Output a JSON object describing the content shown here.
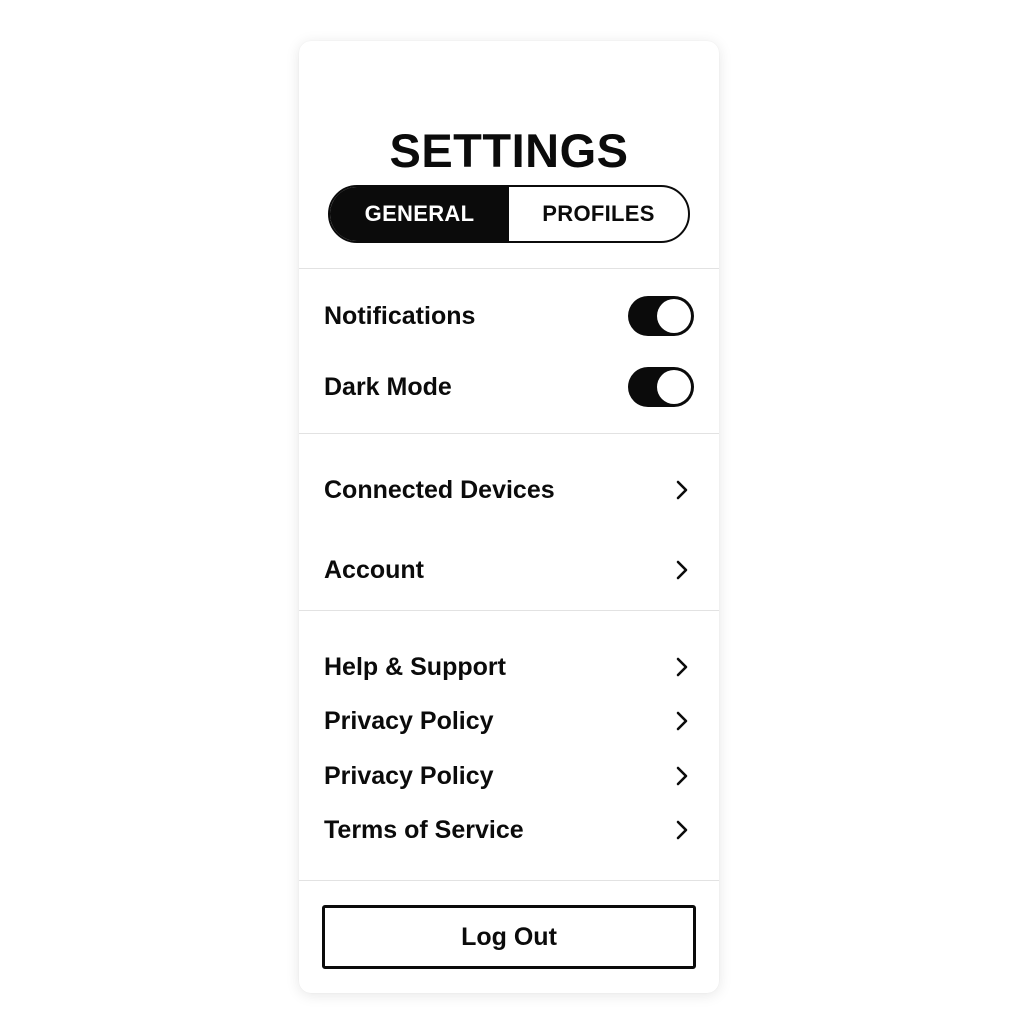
{
  "header": {
    "title": "SETTINGS"
  },
  "tabs": [
    {
      "label": "GENERAL",
      "active": true
    },
    {
      "label": "PROFILES",
      "active": false
    }
  ],
  "toggles": [
    {
      "label": "Notifications",
      "on": true,
      "icon": "toggle-switch"
    },
    {
      "label": "Dark Mode",
      "on": true,
      "icon": "toggle-switch"
    }
  ],
  "links_group_1": [
    {
      "label": "Connected Devices",
      "icon": "chevron-right-icon"
    },
    {
      "label": "Account",
      "icon": "chevron-right-icon"
    }
  ],
  "links_group_2": [
    {
      "label": "Help & Support",
      "icon": "chevron-right-icon"
    },
    {
      "label": "Privacy Policy",
      "icon": "chevron-right-icon"
    },
    {
      "label": "Privacy Policy",
      "icon": "chevron-right-icon"
    },
    {
      "label": "Terms of Service",
      "icon": "chevron-right-icon"
    }
  ],
  "footer": {
    "logout_label": "Log Out"
  },
  "colors": {
    "primary": "#0b0b0b",
    "background": "#ffffff",
    "divider": "#e2e2e2"
  }
}
